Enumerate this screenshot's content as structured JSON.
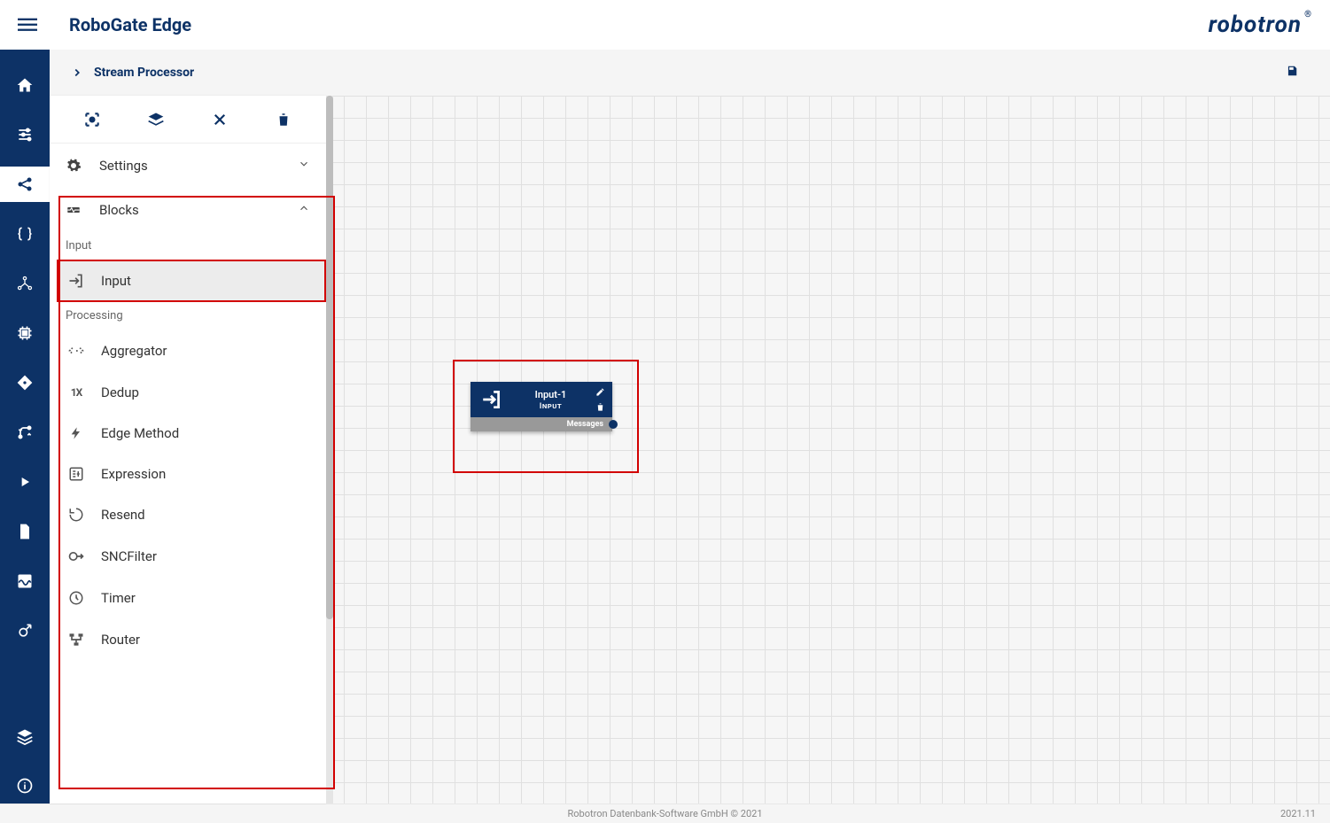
{
  "app_title": "RoboGate Edge",
  "logo_text": "robotron",
  "breadcrumb": {
    "title": "Stream Processor"
  },
  "panel": {
    "sections": {
      "settings": "Settings",
      "blocks": "Blocks"
    },
    "categories": {
      "input": "Input",
      "processing": "Processing"
    },
    "blocks": {
      "input": "Input",
      "aggregator": "Aggregator",
      "dedup": "Dedup",
      "edge_method": "Edge Method",
      "expression": "Expression",
      "resend": "Resend",
      "sncfilter": "SNCFilter",
      "timer": "Timer",
      "router": "Router"
    }
  },
  "canvas_node": {
    "title": "Input-1",
    "type": "Input",
    "port": "Messages"
  },
  "footer": {
    "center": "Robotron Datenbank-Software GmbH © 2021",
    "right": "2021.11"
  }
}
